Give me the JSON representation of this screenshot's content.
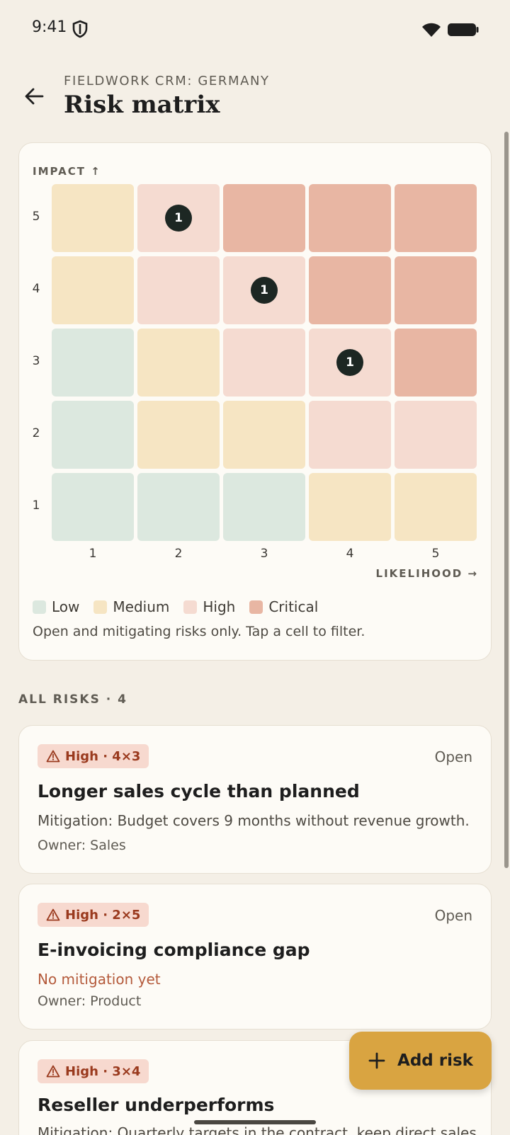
{
  "status_bar": {
    "time": "9:41",
    "shield_icon": "shield-icon",
    "wifi_icon": "wifi-icon",
    "battery_icon": "battery-icon"
  },
  "header": {
    "eyebrow": "FIELDWORK CRM: GERMANY",
    "title": "Risk matrix",
    "back_icon": "arrow-back-icon"
  },
  "matrix": {
    "y_axis_label": "IMPACT ↑",
    "x_axis_label": "LIKELIHOOD →",
    "row_labels": [
      "5",
      "4",
      "3",
      "2",
      "1"
    ],
    "col_labels": [
      "1",
      "2",
      "3",
      "4",
      "5"
    ],
    "grid": [
      [
        "medium",
        "high",
        "critical",
        "critical",
        "critical"
      ],
      [
        "medium",
        "high",
        "high",
        "critical",
        "critical"
      ],
      [
        "low",
        "medium",
        "high",
        "high",
        "critical"
      ],
      [
        "low",
        "medium",
        "medium",
        "high",
        "high"
      ],
      [
        "low",
        "low",
        "low",
        "medium",
        "medium"
      ]
    ],
    "counts": [
      [
        "",
        "1",
        "",
        "",
        ""
      ],
      [
        "",
        "",
        "1",
        "",
        ""
      ],
      [
        "",
        "",
        "",
        "1",
        ""
      ],
      [
        "",
        "",
        "",
        "",
        ""
      ],
      [
        "",
        "",
        "",
        "",
        ""
      ]
    ],
    "legend": [
      {
        "label": "Low",
        "color": "#DCE8DF"
      },
      {
        "label": "Medium",
        "color": "#F6E5C3"
      },
      {
        "label": "High",
        "color": "#F5DBD1"
      },
      {
        "label": "Critical",
        "color": "#E8B6A3"
      }
    ],
    "note": "Open and mitigating risks only. Tap a cell to filter."
  },
  "risks_section": {
    "label": "ALL RISKS · 4"
  },
  "risks": [
    {
      "badge": "High · 4×3",
      "status": "Open",
      "title": "Longer sales cycle than planned",
      "mitigation": "Mitigation: Budget covers 9 months without revenue growth.",
      "owner": "Owner: Sales"
    },
    {
      "badge": "High · 2×5",
      "status": "Open",
      "title": "E-invoicing compliance gap",
      "mitigation": "No mitigation yet",
      "owner": "Owner: Product"
    },
    {
      "badge": "High · 3×4",
      "status": "",
      "title": "Reseller underperforms",
      "mitigation": "Mitigation: Quarterly targets in the contract, keep direct sales",
      "owner": ""
    }
  ],
  "fab": {
    "label": "Add risk",
    "icon": "plus-icon"
  },
  "colors": {
    "accent": "#D9A441",
    "high_badge_text": "#9A3A1E",
    "no_mitigation": "#B45A3B",
    "background": "#F4EFE6"
  }
}
